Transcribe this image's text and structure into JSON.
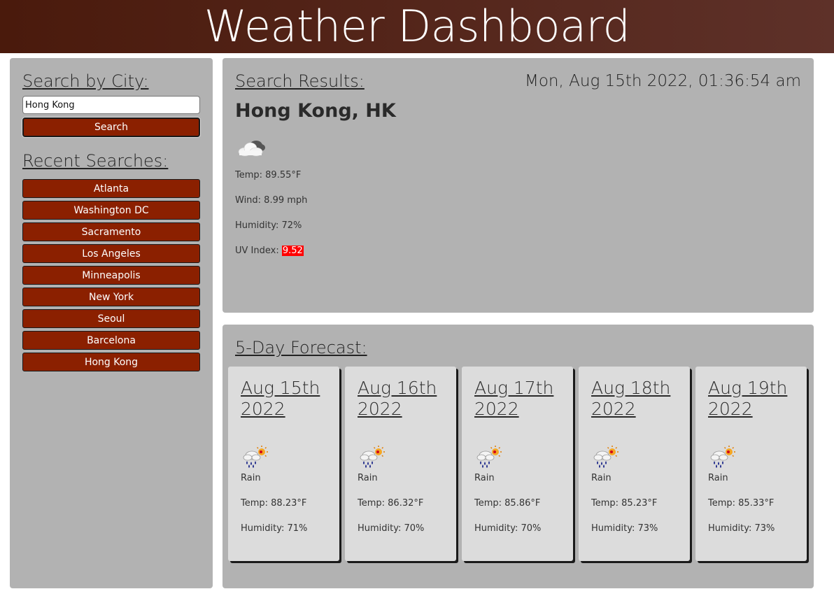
{
  "header": {
    "title": "Weather Dashboard"
  },
  "sidebar": {
    "search_title": "Search by City:",
    "search_value": "Hong Kong",
    "search_button": "Search",
    "recent_title": "Recent Searches:",
    "recent": [
      "Atlanta",
      "Washington DC",
      "Sacramento",
      "Los Angeles",
      "Minneapolis",
      "New York",
      "Seoul",
      "Barcelona",
      "Hong Kong"
    ]
  },
  "results": {
    "title": "Search Results:",
    "datetime": "Mon, Aug 15th 2022, 01:36:54 am",
    "city": "Hong Kong, HK",
    "icon": "cloud-icon",
    "temp": "Temp: 89.55°F",
    "wind": "Wind: 8.99 mph",
    "humidity": "Humidity: 72%",
    "uv_label": "UV Index: ",
    "uv_value": "9.52",
    "uv_color": "#ff0000"
  },
  "forecast": {
    "title": "5-Day Forecast:",
    "days": [
      {
        "date": "Aug 15th 2022",
        "icon": "rain-sun-icon",
        "desc": "Rain",
        "temp": "Temp: 88.23°F",
        "humidity": "Humidity: 71%"
      },
      {
        "date": "Aug 16th 2022",
        "icon": "rain-sun-icon",
        "desc": "Rain",
        "temp": "Temp: 86.32°F",
        "humidity": "Humidity: 70%"
      },
      {
        "date": "Aug 17th 2022",
        "icon": "rain-sun-icon",
        "desc": "Rain",
        "temp": "Temp: 85.86°F",
        "humidity": "Humidity: 70%"
      },
      {
        "date": "Aug 18th 2022",
        "icon": "rain-sun-icon",
        "desc": "Rain",
        "temp": "Temp: 85.23°F",
        "humidity": "Humidity: 73%"
      },
      {
        "date": "Aug 19th 2022",
        "icon": "rain-sun-icon",
        "desc": "Rain",
        "temp": "Temp: 85.33°F",
        "humidity": "Humidity: 73%"
      }
    ]
  },
  "colors": {
    "accent": "#8b2000",
    "header_start": "#4a1a0c",
    "header_end": "#5e3129",
    "panel": "#b2b2b2",
    "card": "#dcdcdc"
  }
}
